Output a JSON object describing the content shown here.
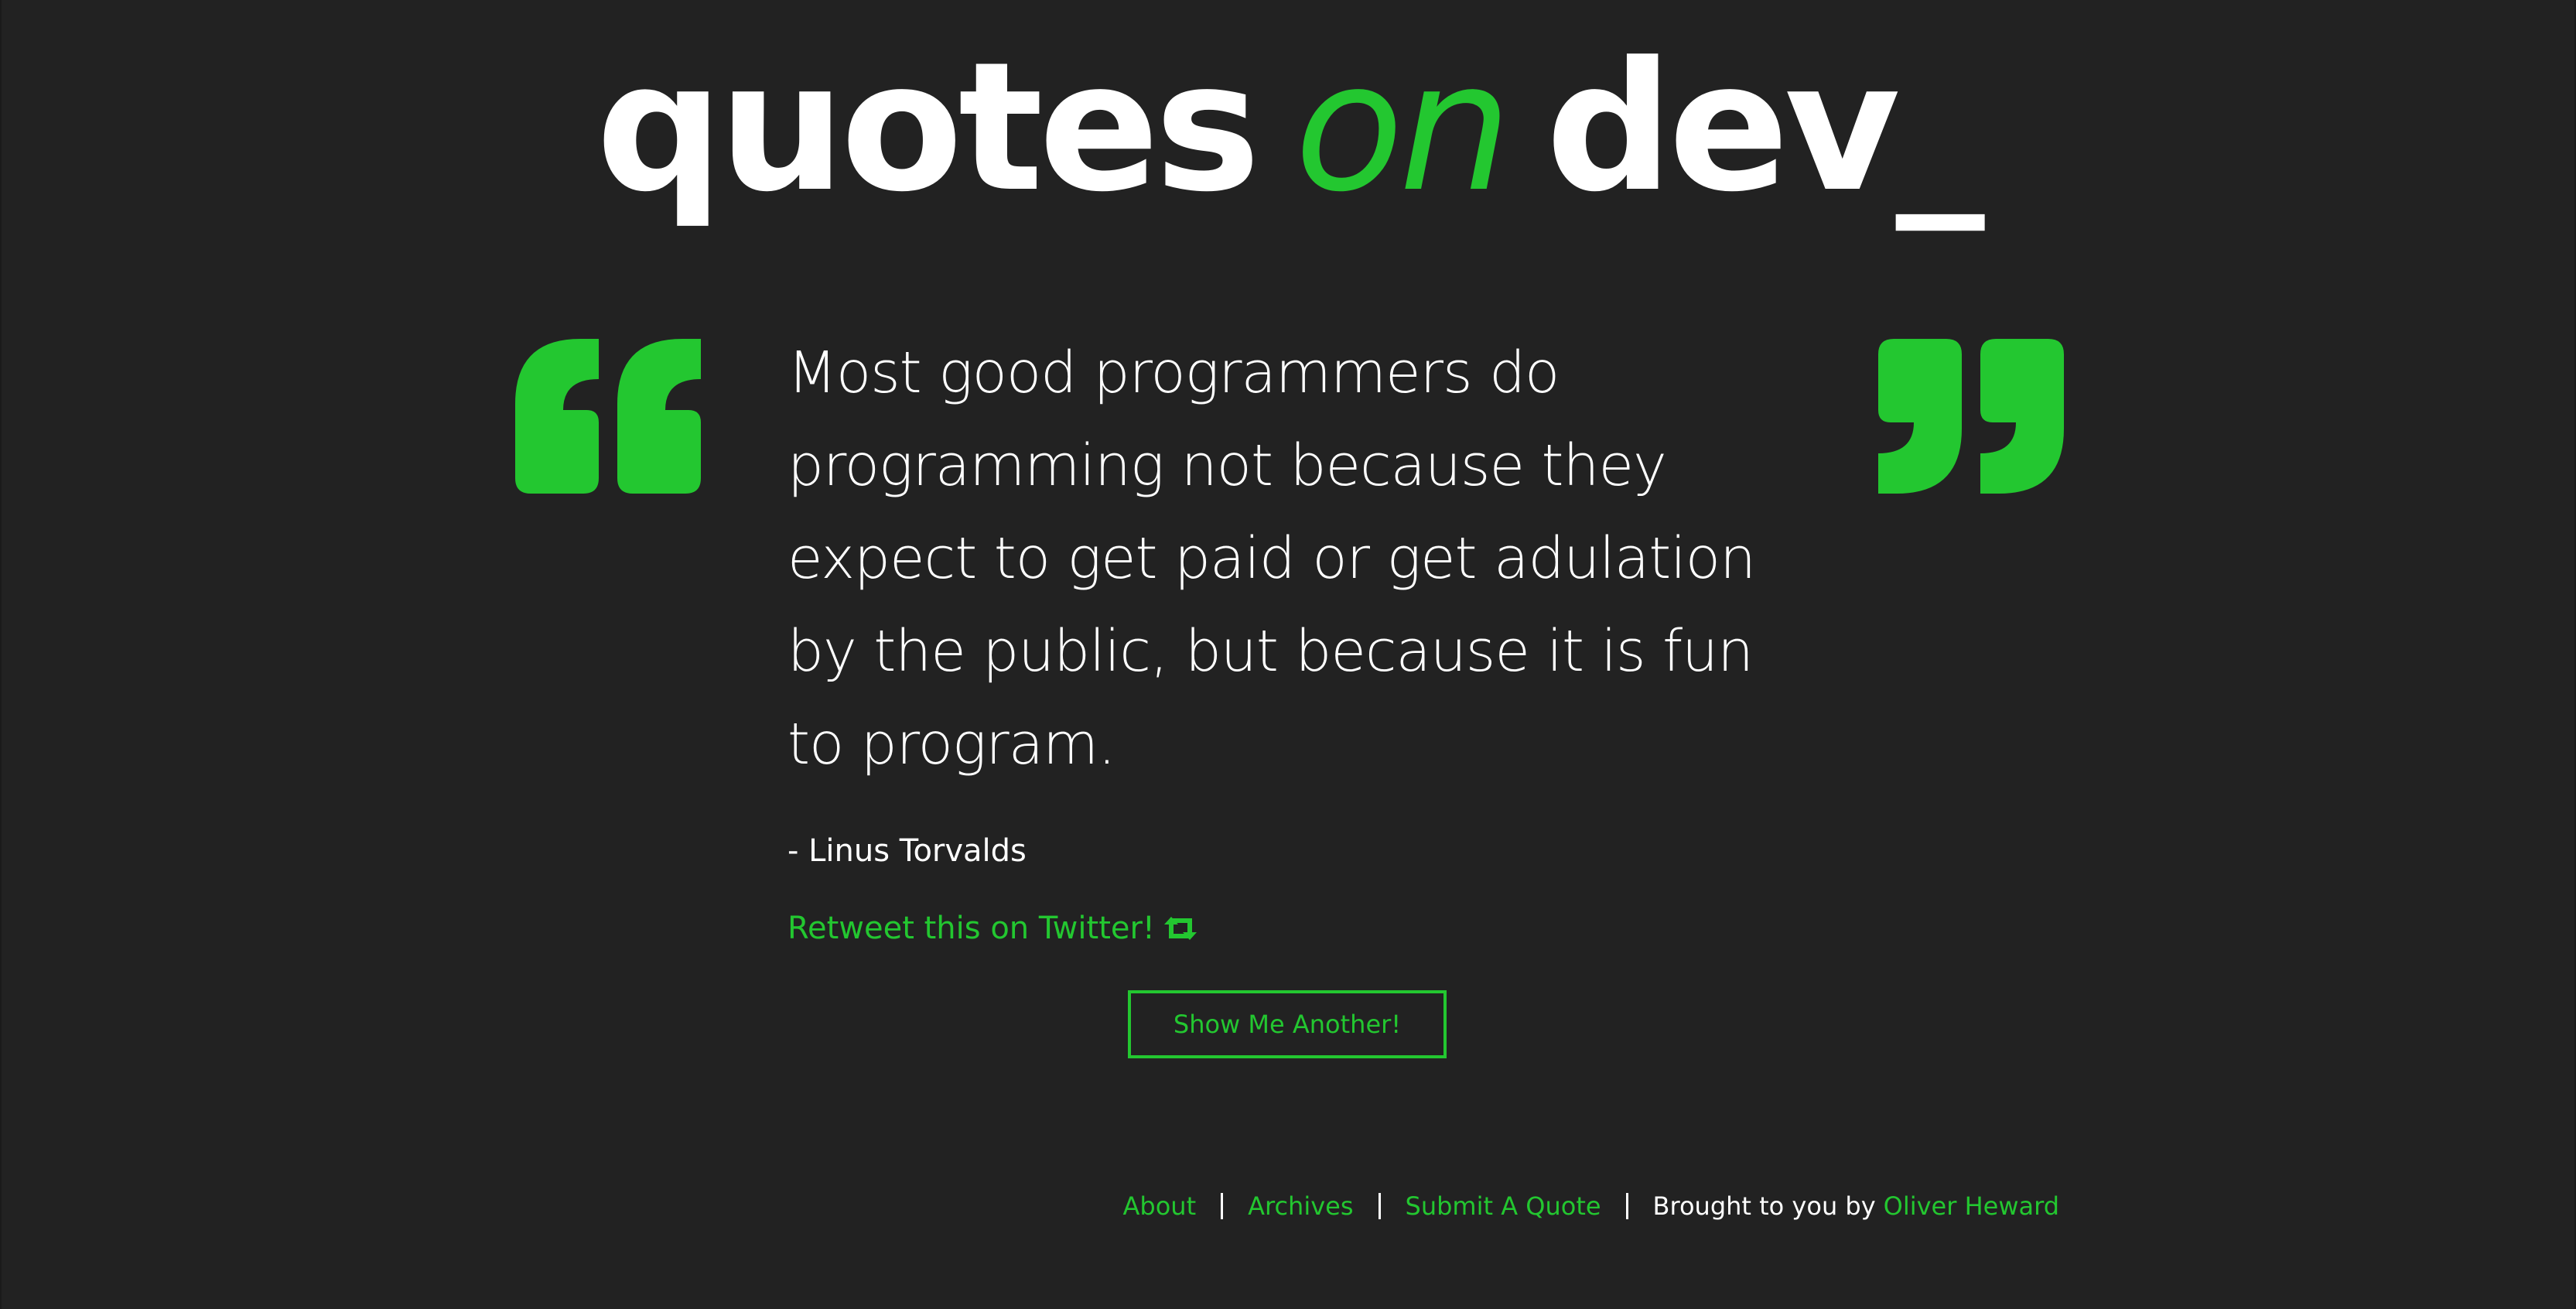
{
  "brand": {
    "logo_word_1": "quotes",
    "logo_word_2": "on",
    "logo_word_3": "dev_"
  },
  "quote": {
    "text": "Most good programmers do programming not because they expect to get paid or get adulation by the public, but because it is fun to program.",
    "author": "- Linus Torvalds",
    "tweet_label": "Retweet this on Twitter!"
  },
  "actions": {
    "show_another_label": "Show Me Another!"
  },
  "footer": {
    "about": "About",
    "archives": "Archives",
    "submit": "Submit A Quote",
    "credit_prefix": "Brought to you by",
    "credit_name": "Oliver Heward"
  },
  "icons": {
    "open_quote": "open-quote-icon",
    "close_quote": "close-quote-icon",
    "retweet": "retweet-icon"
  },
  "colors": {
    "background": "#222222",
    "accent": "#23c730",
    "text": "#ffffff"
  }
}
